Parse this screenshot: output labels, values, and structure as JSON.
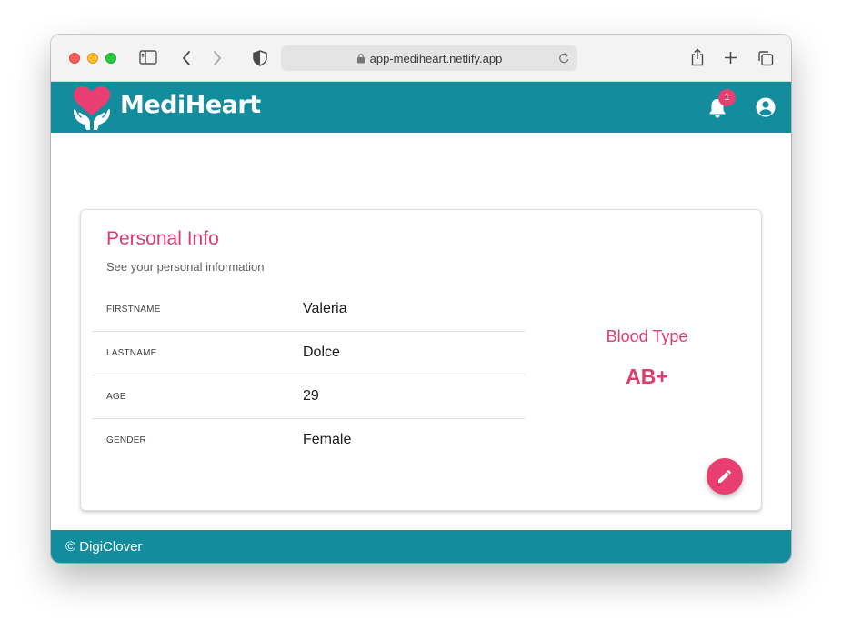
{
  "browser": {
    "url": "app-mediheart.netlify.app"
  },
  "header": {
    "brand": "MediHeart",
    "notification_count": "1"
  },
  "personal_info": {
    "title": "Personal Info",
    "subtitle": "See your personal information",
    "fields": [
      {
        "key": "FIRSTNAME",
        "value": "Valeria"
      },
      {
        "key": "LASTNAME",
        "value": "Dolce"
      },
      {
        "key": "AGE",
        "value": "29"
      },
      {
        "key": "GENDER",
        "value": "Female"
      }
    ],
    "blood_type_label": "Blood Type",
    "blood_type_value": "AB+"
  },
  "footer": {
    "text": "© DigiClover"
  },
  "icons": {
    "sidebar": "sidebar-icon",
    "back": "chevron-left-icon",
    "forward": "chevron-right-icon",
    "privacy": "shield-icon",
    "lock": "lock-icon",
    "reload": "reload-icon",
    "share": "share-icon",
    "new_tab": "plus-icon",
    "tabs": "tabs-overview-icon",
    "logo": "heart-hands-logo",
    "notifications": "bell-icon",
    "account": "account-circle-icon",
    "edit": "pencil-icon"
  },
  "colors": {
    "brand_teal": "#138d9d",
    "accent_pink": "#e93e72",
    "title_pink": "#de3c6e"
  }
}
